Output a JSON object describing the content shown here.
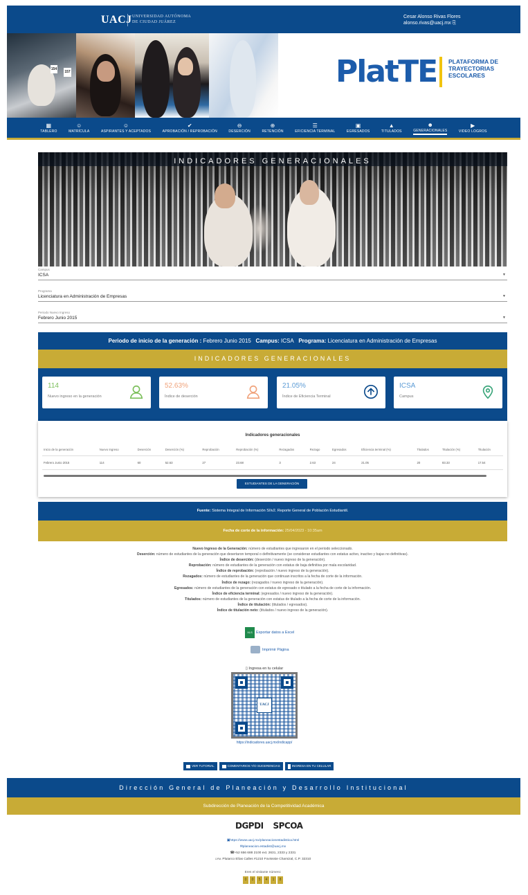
{
  "header": {
    "logo_text": "UACJ",
    "university_line1": "UNIVERSIDAD AUTÓNOMA",
    "university_line2": "DE CIUDAD JUÁREZ",
    "user_name": "Cesar Alonso Rivas Flores",
    "user_email": "alonso.rivas@uacj.mx"
  },
  "brand": {
    "name_plat": "Plat",
    "name_te": "TE",
    "tagline": [
      "PLATAFORMA DE",
      "TRAYECTORIAS",
      "ESCOLARES"
    ]
  },
  "banner_badges": [
    "154",
    "157"
  ],
  "nav": [
    {
      "label": "TABLERO",
      "icon": "dashboard-icon"
    },
    {
      "label": "MATRÍCULA",
      "icon": "students-icon"
    },
    {
      "label": "ASPIRANTES Y ACEPTADOS",
      "icon": "people-icon"
    },
    {
      "label": "APROBACIÓN / REPROBACIÓN",
      "icon": "approval-icon"
    },
    {
      "label": "DESERCIÓN",
      "icon": "minus-circle-icon"
    },
    {
      "label": "RETENCIÓN",
      "icon": "plus-circle-icon"
    },
    {
      "label": "EFICIENCIA TERMINAL",
      "icon": "filter-icon"
    },
    {
      "label": "EGRESADOS",
      "icon": "id-card-icon"
    },
    {
      "label": "TITULADOS",
      "icon": "graduation-cap-icon"
    },
    {
      "label": "GENERACIONALES",
      "icon": "group-icon",
      "active": true
    },
    {
      "label": "VIDEO LOGROS",
      "icon": "video-icon"
    }
  ],
  "hero": {
    "title": "INDICADORES GENERACIONALES"
  },
  "filters": {
    "campus": {
      "label": "Campus",
      "value": "ICSA"
    },
    "programa": {
      "label": "Programa",
      "value": "Licenciatura en Administración de Empresas"
    },
    "periodo": {
      "label": "Periodo Nuevo Ingreso",
      "value": "Febrero Junio 2015"
    }
  },
  "summary": {
    "periodo_label": "Periodo de inicio de la generación :",
    "periodo_value": "Febrero Junio 2015",
    "campus_label": "Campus:",
    "campus_value": "ICSA",
    "programa_label": "Programa:",
    "programa_value": "Licenciatura en Administración de Empresas"
  },
  "section_title": "INDICADORES GENERACIONALES",
  "cards": [
    {
      "value": "114",
      "caption": "Nuevo ingreso en la generación",
      "color": "#7bbf5a",
      "icon": "person-icon"
    },
    {
      "value": "52.63%",
      "caption": "Índice de deserción",
      "color": "#f0a27a",
      "icon": "person-icon"
    },
    {
      "value": "21.05%",
      "caption": "Índice de Eficiencia Terminal",
      "color": "#5b9bd5",
      "icon": "arrow-up-circle-icon"
    },
    {
      "value": "ICSA",
      "caption": "Campus",
      "color": "#5b9bd5",
      "icon": "location-pin-icon"
    }
  ],
  "table": {
    "title": "Indicadores generacionales",
    "headers": [
      "Inicio de la generación",
      "Nuevo Ingreso",
      "Deserción",
      "Deserción (%)",
      "Reprobación",
      "Reprobación (%)",
      "Rezagados",
      "Rezago",
      "Egresados",
      "Eficiencia terminal (%)",
      "Titulados",
      "Titulación (%)",
      "Titulación"
    ],
    "rows": [
      [
        "Febrero Junio 2015",
        "114",
        "60",
        "52.63",
        "27",
        "23.68",
        "3",
        "2.63",
        "24",
        "21.05",
        "20",
        "83.33",
        "17.54"
      ]
    ],
    "button": "ESTUDIANTES DE LA GENERACIÓN"
  },
  "source": {
    "label": "Fuente:",
    "text": "Sistema Integral de Información SIIv2. Reporte General de Población Estudiantil."
  },
  "cutoff": {
    "label": "Fecha de corte de la información:",
    "value": "25/04/2023 - 10:35am"
  },
  "definitions": [
    {
      "term": "Nuevo Ingreso de la Generación:",
      "text": "número de estudiantes que ingresaron en el periodo seleccionado."
    },
    {
      "term": "Deserción:",
      "text": "número de estudiantes de la generación que desertaron temporal o definitivamente (se consideran estudiantes con estatus activo, inactivo y bajas no definitivas)."
    },
    {
      "term": "Índice de deserción:",
      "text": "(deserción / nuevo ingreso de la generación)."
    },
    {
      "term": "Reprobación:",
      "text": "número de estudiantes de la generación con estatus de baja definitiva por mala escolaridad."
    },
    {
      "term": "Índice de reprobación:",
      "text": "(reprobación / nuevo ingreso de la generación)."
    },
    {
      "term": "Rezagados:",
      "text": "número de estudiantes de la generación que continuan inscritos a la fecha de corte de la información."
    },
    {
      "term": "Índice de rezago:",
      "text": "(rezagados / nuevo ingreso de la generación)."
    },
    {
      "term": "Egresados:",
      "text": "número de estudiantes de la generación con estatus de egresado o titulado a la fecha de corte de la información."
    },
    {
      "term": "Índice de eficiencia terminal:",
      "text": "(egresados / nuevo ingreso de la generación)."
    },
    {
      "term": "Titulados:",
      "text": "número de estudiantes de la generación con estatus de titulado a la fecha de corte de la información."
    },
    {
      "term": "Índice de titulación:",
      "text": "(titulados / egresados)."
    },
    {
      "term": "Índice de titulación neto:",
      "text": "(titulados / nuevo ingreso de la generación)."
    }
  ],
  "actions": {
    "excel_icon": "XLS",
    "excel": "Exportar datos a Excel",
    "print": "Imprimir Página"
  },
  "qr": {
    "heading": "Ingresa en tu celular",
    "logo": "UACJ",
    "url": "https://indicadores.uacj.mx/indicapp/"
  },
  "bottom_buttons": [
    "VER TUTORIAL",
    "COMENTARIOS Y/O SUGERENCIAS",
    "INGRESA EN TU CELULAR"
  ],
  "footer": {
    "title": "Dirección General de Planeación y Desarrollo Institucional",
    "subtitle": "Subdirección de Planeación de la Competitividad Académica",
    "logo1": "DGPDI",
    "logo2": "SPCOA",
    "web": "https://www.uacj.mx/planeacionestadistica.html",
    "email": "planeacion.estadist@uacj.mx",
    "phone": "+52 656 688 2100 ext. 2631, 2333 y 2331",
    "address": "Av. Plutarco Elías Calles #1210 Fovissste Chamizal, C.P. 32310",
    "visitor_label": "Eres el visitante número:",
    "visitor_digits": [
      "0",
      "0",
      "5",
      "4",
      "1",
      "8"
    ]
  }
}
